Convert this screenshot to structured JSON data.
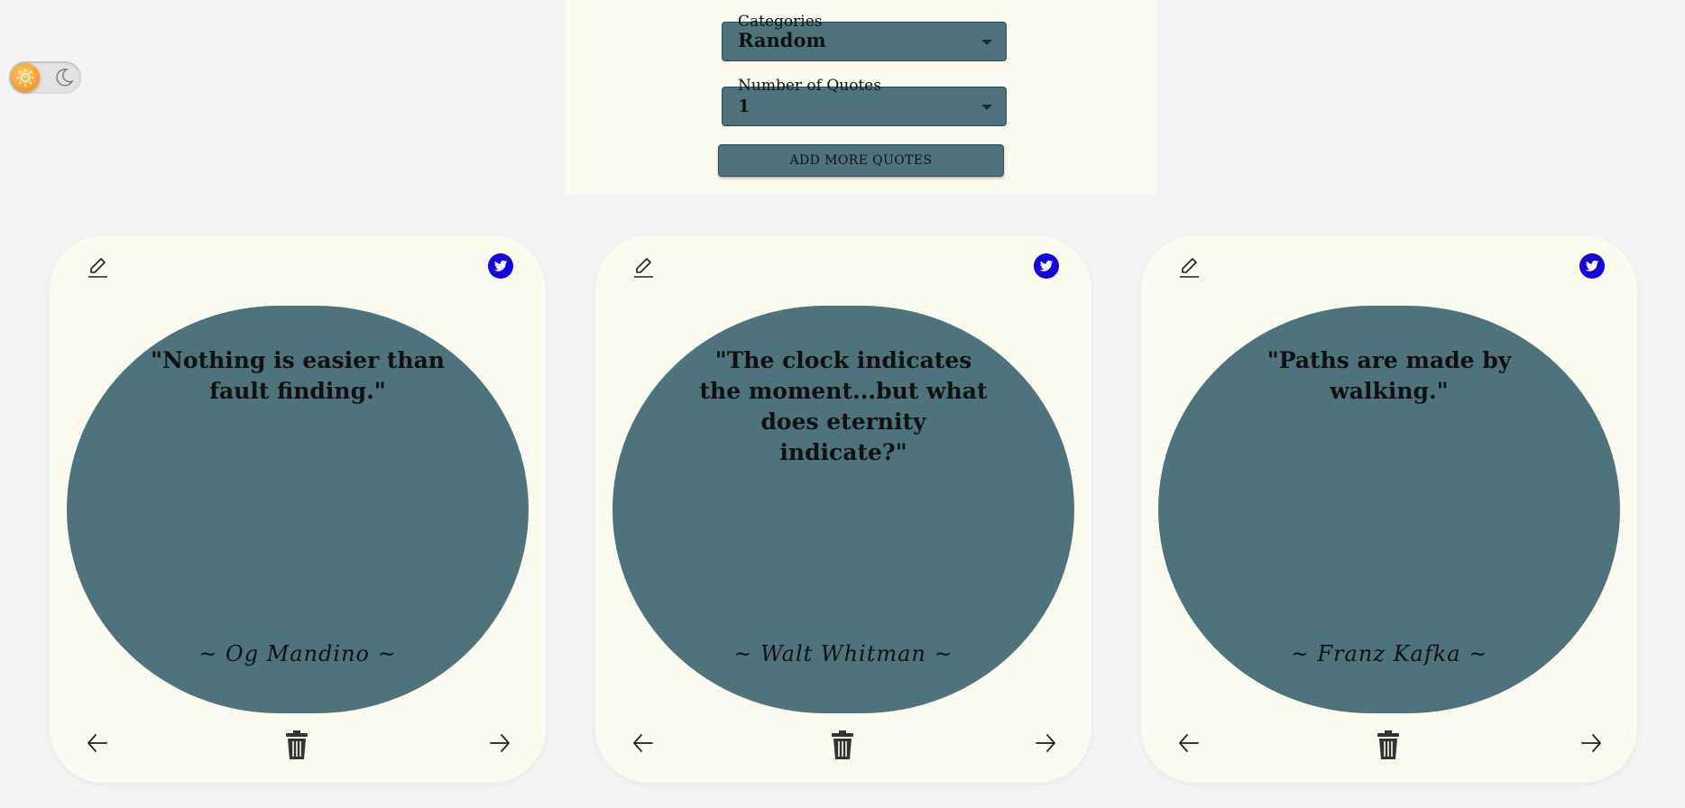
{
  "theme_toggle": {
    "light_icon": "sun-icon",
    "dark_icon": "moon-icon",
    "mode": "light"
  },
  "controls": {
    "categories": {
      "label": "Categories",
      "value": "Random"
    },
    "number_of_quotes": {
      "label": "Number of Quotes",
      "value": "1"
    },
    "add_button_label": "ADD MORE QUOTES"
  },
  "colors": {
    "accent": "#4f737d",
    "card_bg": "#fbfbf0",
    "page_bg": "#f4f4f4",
    "twitter": "#1400e6"
  },
  "cards": [
    {
      "quote": "\"Nothing is easier than fault finding.\"",
      "author": "~ Og Mandino ~"
    },
    {
      "quote": "\"The clock indicates the moment...but what does eternity indicate?\"",
      "author": "~ Walt Whitman ~"
    },
    {
      "quote": "\"Paths are made by walking.\"",
      "author": "~ Franz Kafka ~"
    }
  ]
}
